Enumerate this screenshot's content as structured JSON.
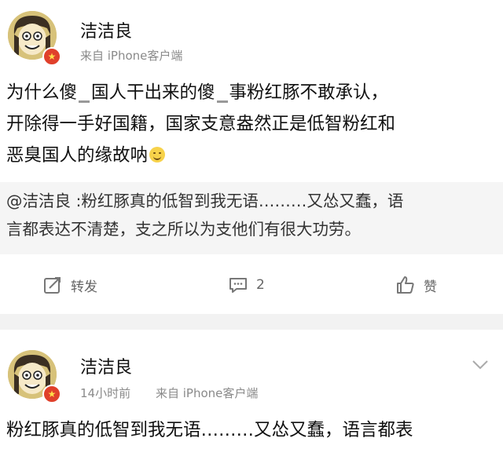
{
  "post1": {
    "username": "洁洁良",
    "source": "来自 iPhone客户端",
    "content_line1": "为什么傻",
    "content_line1b": "国人干出来的傻",
    "content_line1c": "事粉红豚不敢承认，",
    "content_line2": "开除得一手好国籍，国家支意盎然正是低智粉红和",
    "content_line3": "恶臭国人的缘故呐",
    "quote_mention": "@洁洁良",
    "quote_line1": " :粉红豚真的低智到我无语………又怂又蠢，语",
    "quote_line2": "言都表达不清楚，支之所以为支他们有很大功劳。",
    "actions": {
      "repost_label": "转发",
      "comment_count": "2",
      "like_label": "赞"
    }
  },
  "post2": {
    "username": "洁洁良",
    "time": "14小时前",
    "source": "来自 iPhone客户端",
    "content_line1": "粉红豚真的低智到我无语………又怂又蠢，语言都表"
  },
  "colors": {
    "vip_badge": "#e0402b",
    "separator": "#f2f2f2",
    "quote_bg": "#f5f5f5"
  },
  "icons": [
    "vip-badge-icon",
    "repost-icon",
    "comment-icon",
    "like-icon",
    "chevron-down-icon",
    "smile-emoji-icon"
  ]
}
